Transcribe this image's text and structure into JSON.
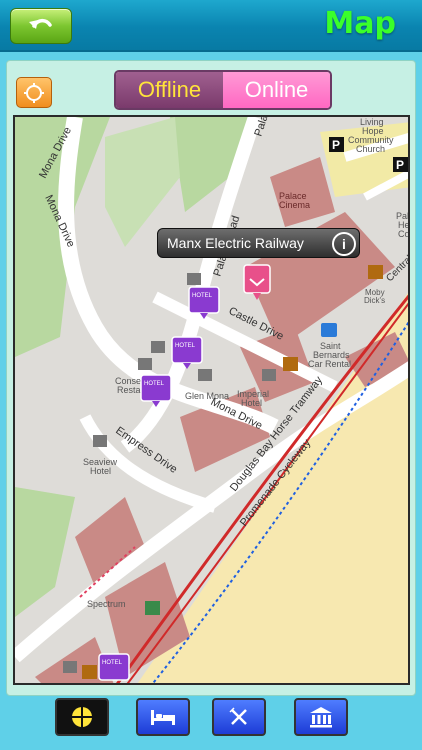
{
  "header": {
    "title": "Map",
    "back_icon": "back-arrow-icon"
  },
  "mode_toggle": {
    "offline_label": "Offline",
    "online_label": "Online",
    "selected": "Offline"
  },
  "locate_button": {
    "icon": "target-locate-icon"
  },
  "callout": {
    "title": "Manx Electric Railway",
    "info_icon": "i"
  },
  "map": {
    "roads": {
      "mona_drive_nw": "Mona Drive",
      "mona_drive_w": "Mona Drive",
      "palace_road": "Palace Road",
      "pala_top": "Pala",
      "castle_drive": "Castle Drive",
      "mona_drive_mid": "Mona Drive",
      "empress_drive": "Empress Drive",
      "tramway": "Douglas Bay Horse Tramway",
      "cycleway": "Promenade Cycleway",
      "central": "Central"
    },
    "places": {
      "living_hope_1": "Living",
      "living_hope_2": "Hope",
      "living_hope_3": "Community",
      "living_hope_4": "Church",
      "palace_cinema_1": "Palace",
      "palace_cinema_2": "Cinema",
      "pala_he_1": "Pala",
      "pala_he_2": "He",
      "pala_he_3": "Co",
      "moby_1": "Moby",
      "moby_2": "Dick's",
      "saint_bernards_1": "Saint",
      "saint_bernards_2": "Bernards",
      "saint_bernards_3": "Car Rental",
      "imperial_1": "Imperial",
      "imperial_2": "Hotel",
      "glen_mona": "Glen Mona",
      "conse_1": "Conse",
      "conse_2": "Resta",
      "seaview_1": "Seaview",
      "seaview_2": "Hotel",
      "spectrum": "Spectrum"
    },
    "parking_label": "P",
    "hotel_badge": "HOTEL"
  },
  "bottom_tabs": [
    {
      "name": "map",
      "icon": "crosshair-icon",
      "active": true
    },
    {
      "name": "hotels",
      "icon": "bed-icon",
      "active": false
    },
    {
      "name": "restaurants",
      "icon": "fork-knife-icon",
      "active": false
    },
    {
      "name": "attractions",
      "icon": "museum-icon",
      "active": false
    }
  ],
  "colors": {
    "topbar": "#0a84b0",
    "title": "#3aff2a",
    "back_button": "#7cc630",
    "offline_bg": "#7a3a6c",
    "offline_text": "#ffe43a",
    "online_bg": "#ff68c2",
    "map_land": "#dedcd8",
    "map_green": "#b8d8a0",
    "map_building": "#c98a86",
    "map_beach": "#f7e8b0",
    "tram_line": "#d02a2a",
    "tab_button": "#1d3cd6"
  }
}
